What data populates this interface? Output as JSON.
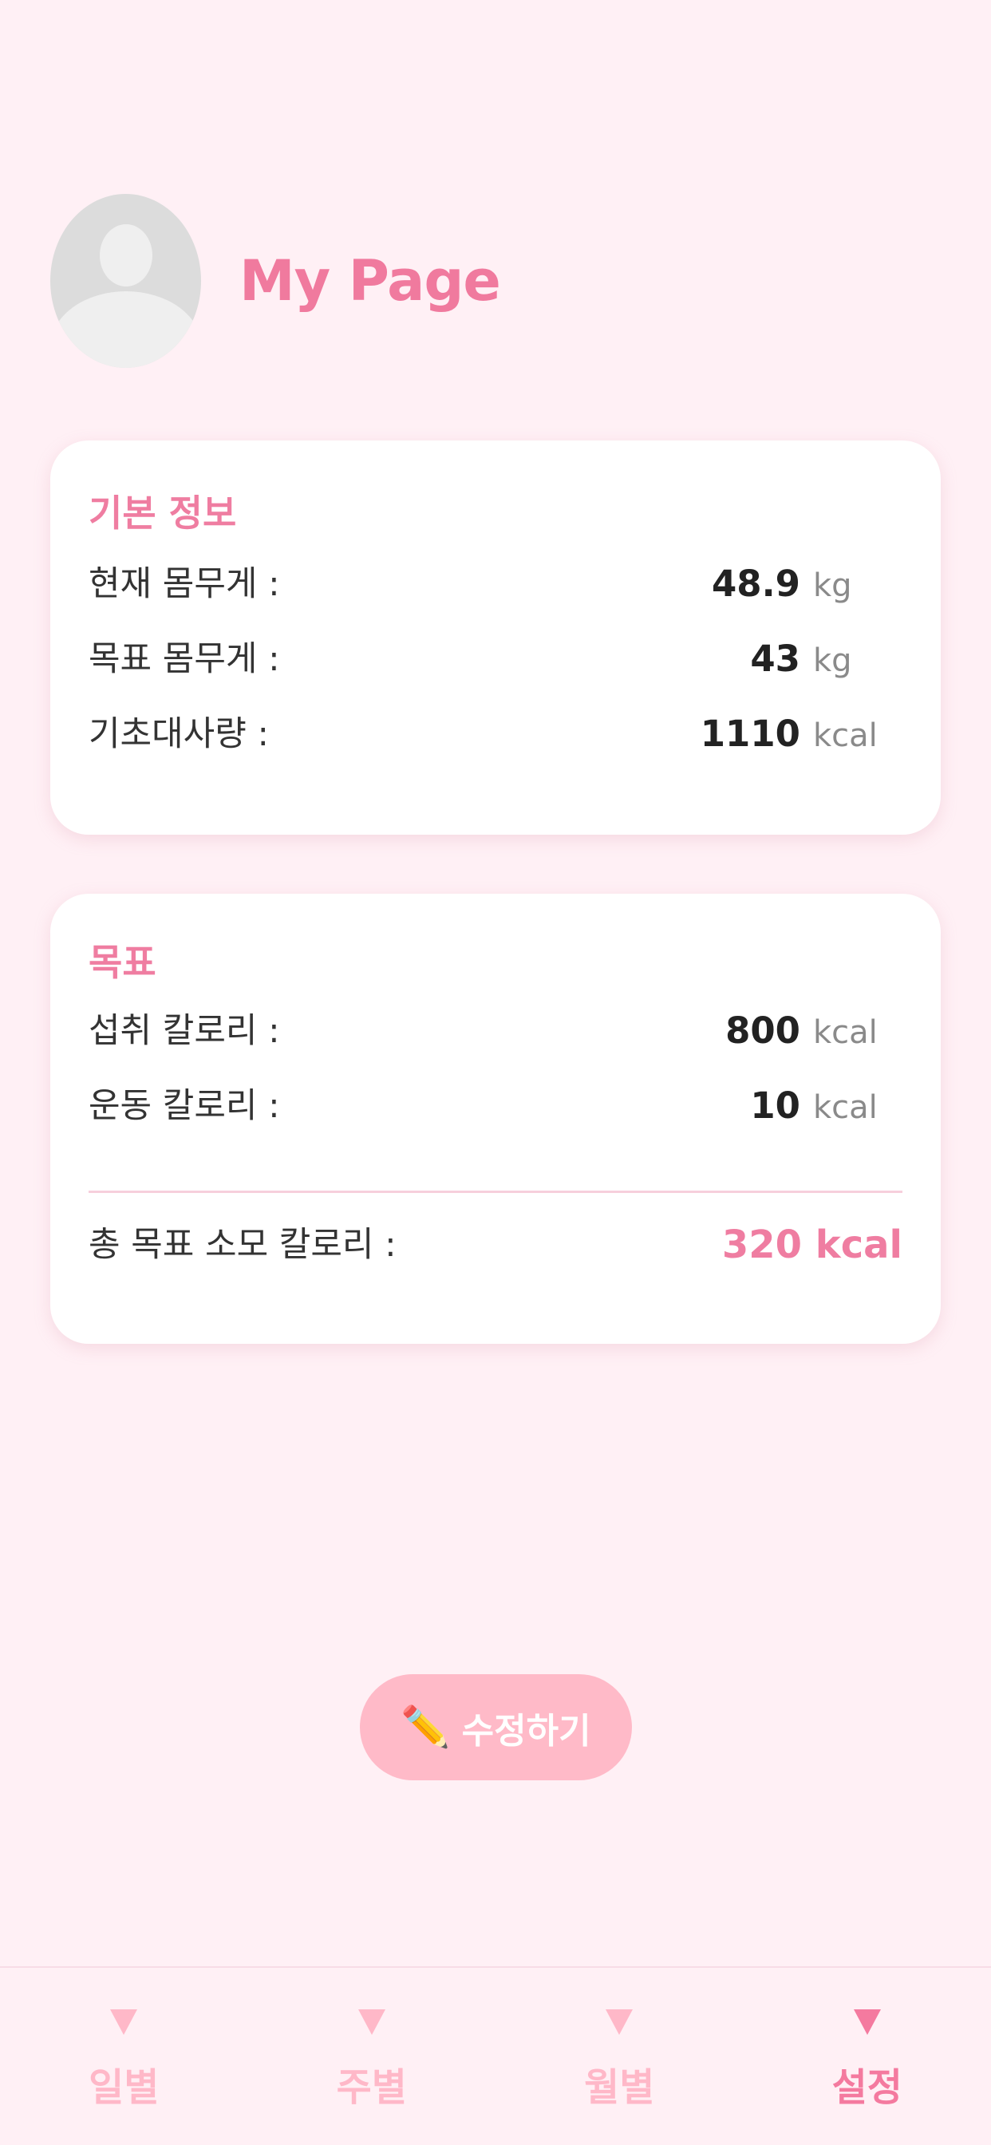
{
  "header": {
    "title": "My Page",
    "avatar_icon": "user-avatar-placeholder-icon"
  },
  "basic_info": {
    "title": "기본 정보",
    "rows": [
      {
        "label": "현재 몸무게 :",
        "value": "48.9",
        "unit": "kg"
      },
      {
        "label": "목표 몸무게 :",
        "value": "43",
        "unit": "kg"
      },
      {
        "label": "기초대사량 :",
        "value": "1110",
        "unit": "kcal"
      }
    ]
  },
  "goal": {
    "title": "목표",
    "rows": [
      {
        "label": "섭취 칼로리 :",
        "value": "800",
        "unit": "kcal"
      },
      {
        "label": "운동 칼로리 :",
        "value": "10",
        "unit": "kcal"
      }
    ],
    "total_label": "총 목표 소모 칼로리 :",
    "total_value": "320 kcal"
  },
  "edit_button": {
    "icon": "pencil-icon",
    "icon_glyph": "✏️",
    "label": "수정하기"
  },
  "bottom_nav": {
    "items": [
      {
        "label": "일별",
        "icon": "triangle-down-icon",
        "active": false
      },
      {
        "label": "주별",
        "icon": "triangle-down-icon",
        "active": false
      },
      {
        "label": "월별",
        "icon": "triangle-down-icon",
        "active": false
      },
      {
        "label": "설정",
        "icon": "triangle-down-icon",
        "active": true
      }
    ]
  },
  "colors": {
    "background": "#fff0f5",
    "accent": "#ef7da1",
    "button": "#ffbac8",
    "nav_inactive": "#ffb8c8"
  }
}
